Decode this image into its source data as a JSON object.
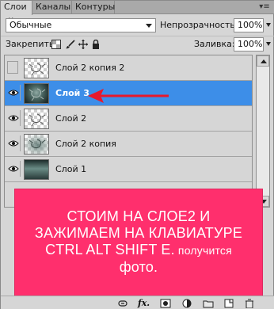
{
  "tabs": [
    {
      "label": "Слои",
      "active": true
    },
    {
      "label": "Каналы",
      "active": false
    },
    {
      "label": "Контуры",
      "active": false
    }
  ],
  "blend": {
    "mode": "Обычные",
    "opacity_label": "Непрозрачность:",
    "opacity_value": "100%",
    "lock_label": "Закрепить:",
    "fill_label": "Заливка:",
    "fill_value": "100%"
  },
  "layers": [
    {
      "name": "Слой 2 копия 2",
      "visible": false,
      "selected": false,
      "thumb": "checker-swirl"
    },
    {
      "name": "Слой 3",
      "visible": true,
      "selected": true,
      "thumb": "photo"
    },
    {
      "name": "Слой 2",
      "visible": true,
      "selected": false,
      "thumb": "checker-swirl"
    },
    {
      "name": "Слой 2 копия",
      "visible": true,
      "selected": false,
      "thumb": "faded-photo"
    },
    {
      "name": "Слой 1",
      "visible": true,
      "selected": false,
      "thumb": "gradient"
    }
  ],
  "callout": {
    "line1": "СТОИМ НА СЛОЕ2 И",
    "line2": "ЗАЖИМАЕМ НА КЛАВИАТУРЕ",
    "line3": "CTRL  ALT SHIFT  E.",
    "line3_small": " получится",
    "line4": "фото.",
    "color": "#ff2f6d"
  },
  "colors": {
    "selected": "#3d8ee8",
    "arrow": "#e8192c"
  },
  "icons": [
    "link-layers-icon",
    "fx-icon",
    "mask-icon",
    "adjustment-icon",
    "group-folder-icon",
    "new-layer-icon",
    "trash-icon"
  ]
}
